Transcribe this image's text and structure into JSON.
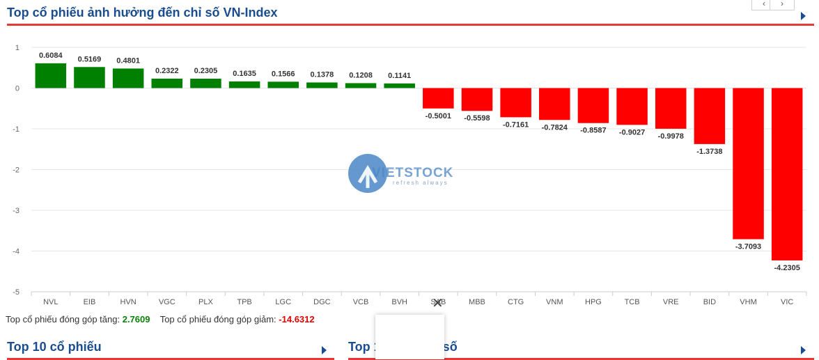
{
  "header": {
    "title": "Top cổ phiếu ảnh hưởng đến chỉ số VN-Index",
    "prev_label": "‹",
    "next_label": "›"
  },
  "chart_data": {
    "type": "bar",
    "title": "",
    "xlabel": "",
    "ylabel": "",
    "ylim": [
      -5,
      1
    ],
    "yticks": [
      1,
      0,
      -1,
      -2,
      -3,
      -4,
      -5
    ],
    "grid": true,
    "categories": [
      "NVL",
      "EIB",
      "HVN",
      "VGC",
      "PLX",
      "TPB",
      "LGC",
      "DGC",
      "VCB",
      "BVH",
      "SAB",
      "MBB",
      "CTG",
      "VNM",
      "HPG",
      "TCB",
      "VRE",
      "BID",
      "VHM",
      "VIC"
    ],
    "values": [
      0.6084,
      0.5169,
      0.4801,
      0.2322,
      0.2305,
      0.1635,
      0.1566,
      0.1378,
      0.1208,
      0.1141,
      -0.5001,
      -0.5598,
      -0.7161,
      -0.7824,
      -0.8587,
      -0.9027,
      -0.9978,
      -1.3738,
      -3.7093,
      -4.2305
    ],
    "value_labels": [
      "0.6084",
      "0.5169",
      "0.4801",
      "0.2322",
      "0.2305",
      "0.1635",
      "0.1566",
      "0.1378",
      "0.1208",
      "0.1141",
      "-0.5001",
      "-0.5598",
      "-0.7161",
      "-0.7824",
      "-0.8587",
      "-0.9027",
      "-0.9978",
      "-1.3738",
      "-3.7093",
      "-4.2305"
    ],
    "colors": {
      "positive": "#008000",
      "negative": "#ff0000"
    }
  },
  "summary": {
    "up_label": "Top cổ phiếu đóng góp tăng:",
    "up_value": "2.7609",
    "down_label": "Top cổ phiếu đóng góp giảm:",
    "down_value": "-14.6312"
  },
  "watermark": {
    "brand": "VIETSTOCK",
    "tagline": "refresh always"
  },
  "bottom_sections": {
    "left_title": "Top 10 cổ phiếu",
    "right_title": "Top 10 theo chỉ số"
  },
  "colors": {
    "title_blue": "#1a4d8f",
    "accent_red": "#e53935"
  }
}
